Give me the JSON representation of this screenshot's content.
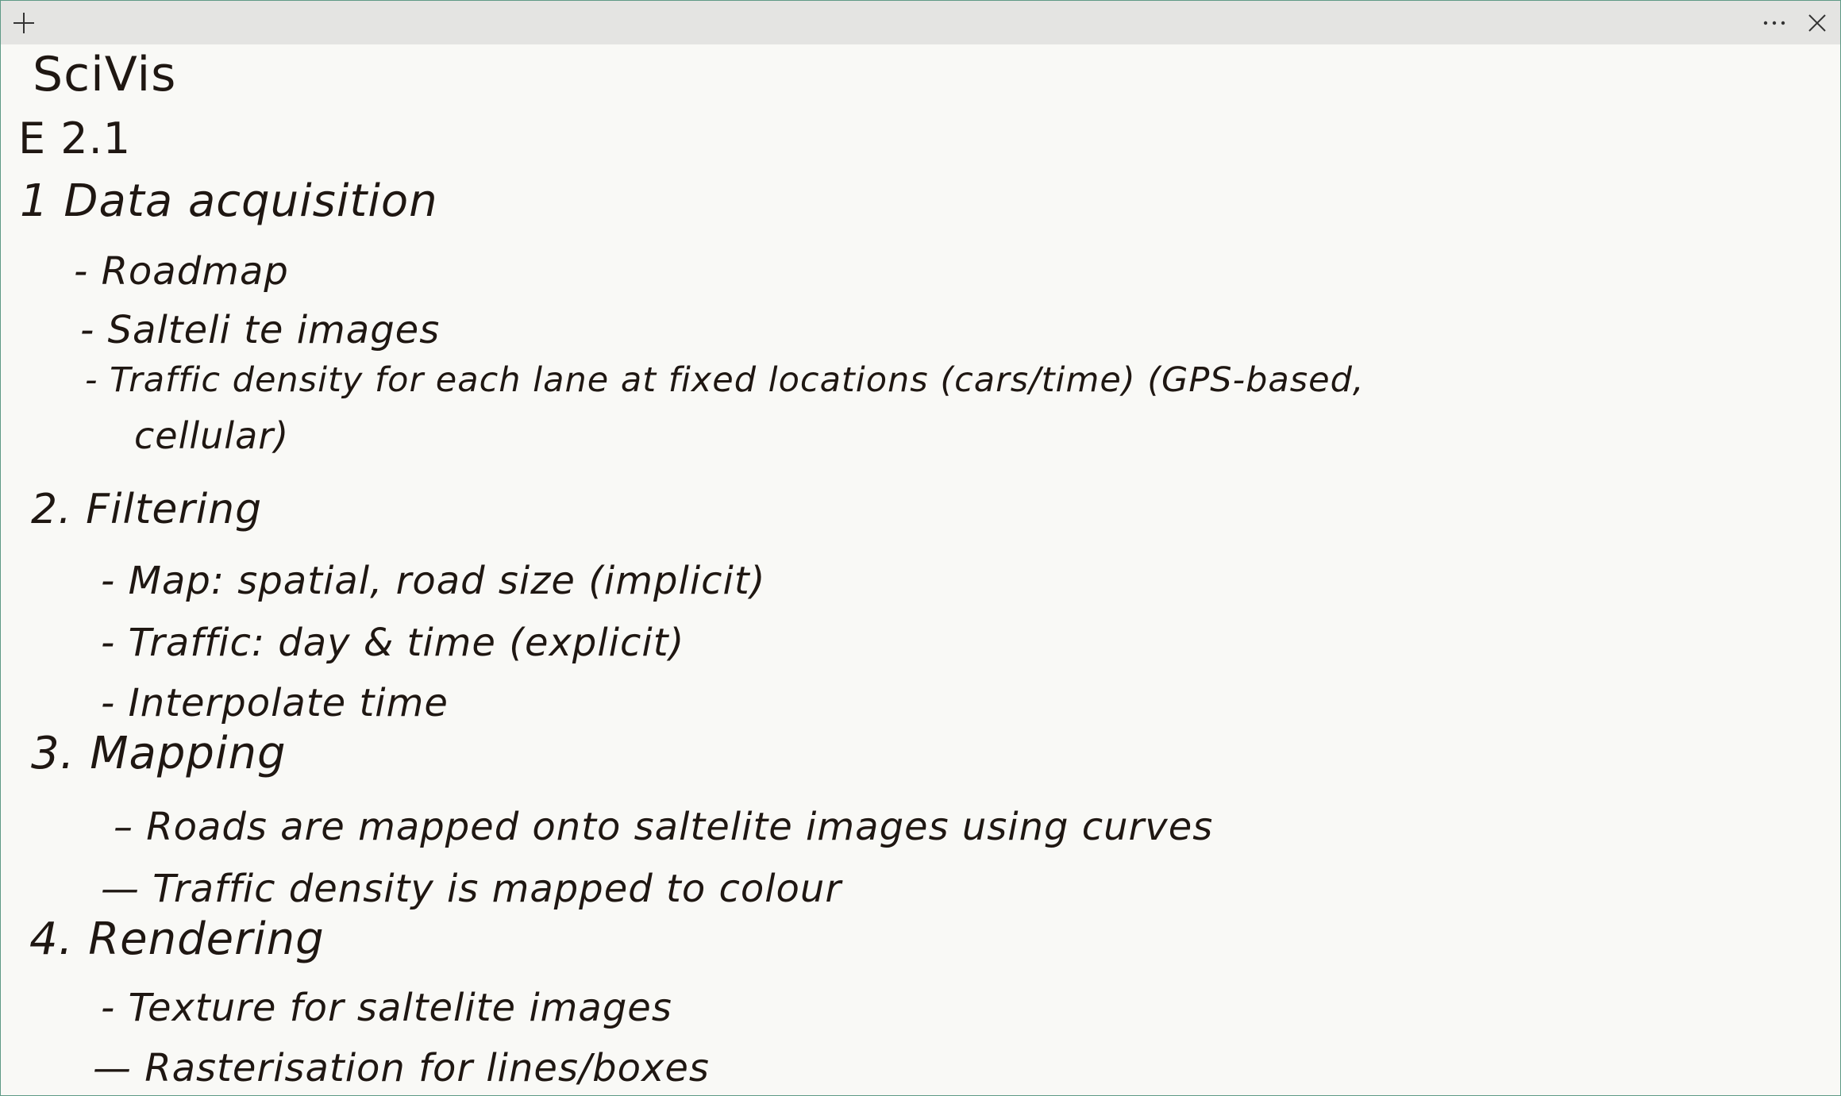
{
  "window": {
    "new_note_icon": "plus-icon",
    "more_icon": "more-horizontal-icon",
    "close_icon": "close-icon"
  },
  "note": {
    "title": "SciVis",
    "exercise": "E 2.1",
    "sections": [
      {
        "heading": "1 Data acquisition",
        "items": [
          "- Roadmap",
          "- Salteli te images",
          "- Traffic density for each lane at fixed locations (cars/time) (GPS-based,",
          "cellular)"
        ]
      },
      {
        "heading": "2. Filtering",
        "items": [
          "- Map: spatial, road size (implicit)",
          "- Traffic: day & time (explicit)",
          "- Interpolate time"
        ]
      },
      {
        "heading": "3. Mapping",
        "items": [
          "– Roads are mapped onto saltelite images using curves",
          "— Traffic density is mapped to colour"
        ]
      },
      {
        "heading": "4. Rendering",
        "items": [
          "- Texture for saltelite images",
          "— Rasterisation for lines/boxes"
        ]
      }
    ]
  },
  "colors": {
    "ink": "#1f1712",
    "paper": "#f9f9f6",
    "titlebar": "#e4e4e2",
    "border": "#5f9a86"
  }
}
